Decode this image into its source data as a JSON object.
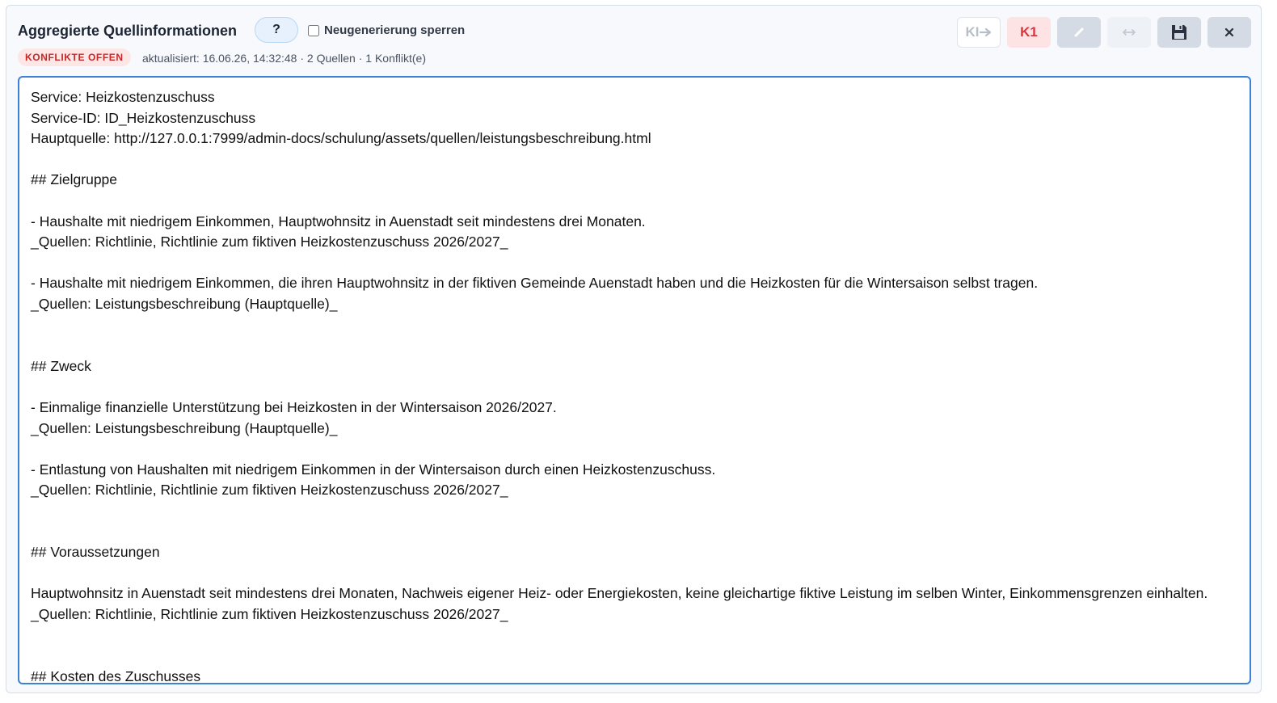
{
  "panel": {
    "title": "Aggregierte Quellinformationen",
    "help_label": "?",
    "lock_label": "Neugenerierung sperren",
    "lock_checked": false,
    "badge": "KONFLIKTE OFFEN",
    "status": "aktualisiert: 16.06.26, 14:32:48 · 2 Quellen · 1 Konflikt(e)"
  },
  "toolbar": {
    "ki_label": "KI",
    "ki_icon": "arrow-right-icon",
    "k1_label": "K1",
    "edit_icon": "pencil-icon",
    "diff_icon": "swap-horizontal-icon",
    "save_icon": "floppy-disk-icon",
    "close_icon": "close-icon"
  },
  "colors": {
    "accent": "#3b82d6",
    "conflict": "#d9363e",
    "badge_bg": "#fde6e6"
  },
  "content": "Service: Heizkostenzuschuss\nService-ID: ID_Heizkostenzuschuss\nHauptquelle: http://127.0.0.1:7999/admin-docs/schulung/assets/quellen/leistungsbeschreibung.html\n\n## Zielgruppe\n\n- Haushalte mit niedrigem Einkommen, Hauptwohnsitz in Auenstadt seit mindestens drei Monaten.\n_Quellen: Richtlinie, Richtlinie zum fiktiven Heizkostenzuschuss 2026/2027_\n\n- Haushalte mit niedrigem Einkommen, die ihren Hauptwohnsitz in der fiktiven Gemeinde Auenstadt haben und die Heizkosten für die Wintersaison selbst tragen.\n_Quellen: Leistungsbeschreibung (Hauptquelle)_\n\n\n## Zweck\n\n- Einmalige finanzielle Unterstützung bei Heizkosten in der Wintersaison 2026/2027.\n_Quellen: Leistungsbeschreibung (Hauptquelle)_\n\n- Entlastung von Haushalten mit niedrigem Einkommen in der Wintersaison durch einen Heizkostenzuschuss.\n_Quellen: Richtlinie, Richtlinie zum fiktiven Heizkostenzuschuss 2026/2027_\n\n\n## Voraussetzungen\n\nHauptwohnsitz in Auenstadt seit mindestens drei Monaten, Nachweis eigener Heiz- oder Energiekosten, keine gleichartige fiktive Leistung im selben Winter, Einkommensgrenzen einhalten.\n_Quellen: Richtlinie, Richtlinie zum fiktiven Heizkostenzuschuss 2026/2027_\n\n\n## Kosten des Zuschusses"
}
